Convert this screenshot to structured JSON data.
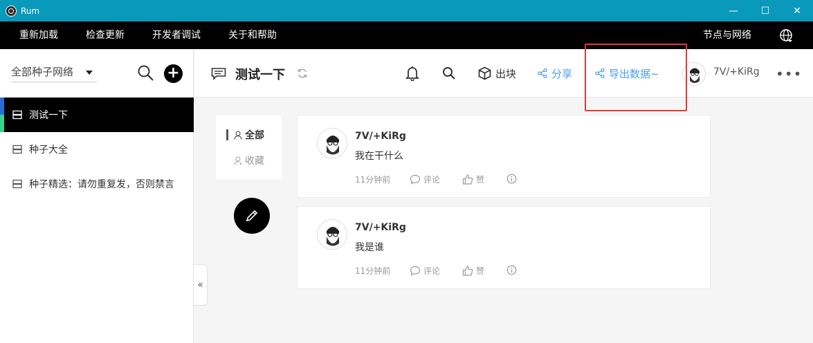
{
  "window": {
    "title": "Rum",
    "minimize": "—",
    "maximize": "☐",
    "close": "✕"
  },
  "menu": {
    "items": [
      "重新加载",
      "检查更新",
      "开发者调试",
      "关于和帮助"
    ],
    "right": "节点与网络"
  },
  "sidebar": {
    "network_select": "全部种子网络",
    "items": [
      {
        "label": "测试一下",
        "active": true
      },
      {
        "label": "种子大全",
        "active": false
      },
      {
        "label": "种子精选：请勿重复发，否则禁言",
        "active": false
      }
    ],
    "collapse": "«"
  },
  "header": {
    "group_title": "测试一下",
    "produce_label": "出块",
    "share_label": "分享",
    "export_label": "导出数据~",
    "username": "7V/+KiRg",
    "more": "•••"
  },
  "filters": {
    "all": "全部",
    "favorites": "收藏"
  },
  "posts": [
    {
      "author": "7V/+KiRg",
      "content": "我在干什么",
      "time": "11分钟前",
      "comment": "评论",
      "like": "赞"
    },
    {
      "author": "7V/+KiRg",
      "content": "我是谁",
      "time": "11分钟前",
      "comment": "评论",
      "like": "赞"
    }
  ],
  "colors": {
    "titlebar": "#0899bb",
    "menubar": "#000000",
    "accent_blue": "#4d9ee8",
    "highlight": "#e53935"
  }
}
